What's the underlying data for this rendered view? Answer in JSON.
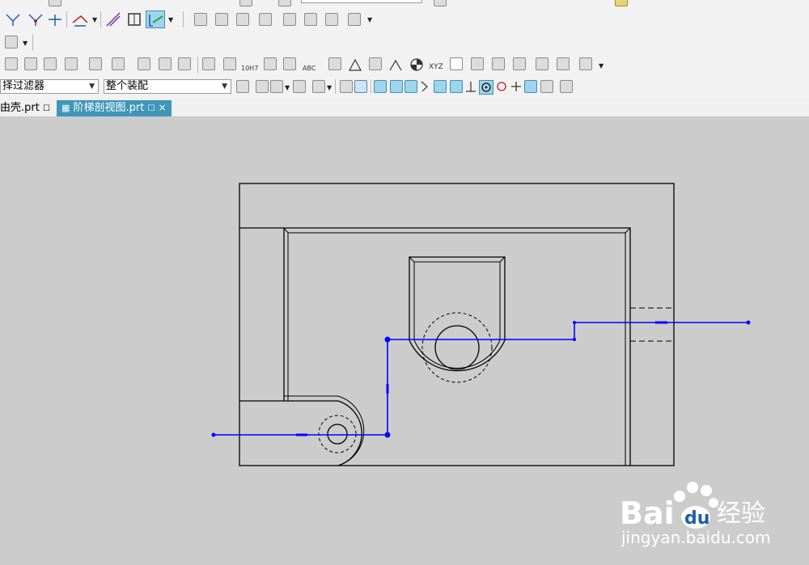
{
  "toolbar": {
    "selection_filter": {
      "value": "择过滤器"
    },
    "assembly_scope": {
      "value": "整个装配"
    },
    "icons": [
      "section-line-icon",
      "add-segment-icon",
      "delete-segment-icon",
      "move-segment-icon",
      "section-view-icon",
      "projected-view-icon",
      "step-section-active-icon",
      "base-view-icon",
      "view-style-icon",
      "update-view-icon",
      "view-boundary-icon",
      "break-view-icon",
      "detail-view-icon",
      "centerline-icon",
      "symmetric-centerline-icon",
      "bolt-circle-icon",
      "offset-centerpoint-icon",
      "dimension-icon",
      "tolerance-icon",
      "note-icon",
      "feature-control-frame-icon",
      "datum-icon",
      "surface-finish-icon",
      "weld-icon",
      "target-point-icon",
      "xyz-icon",
      "table-icon",
      "part-list-icon",
      "balloon-icon",
      "crosshatch-icon",
      "image-icon",
      "settings-icon",
      "pattern-icon",
      "show-hide-icon",
      "layer-icon",
      "snap-endpoint-icon",
      "snap-midpoint-icon",
      "snap-control-icon",
      "snap-tangent-icon",
      "snap-center-icon",
      "snap-quadrant-icon",
      "snap-intersection-icon",
      "snap-on-curve-icon",
      "snap-point-icon"
    ],
    "labels": {
      "dimension_fit": "10H7",
      "xyz": "XYZ",
      "abc": "ABC"
    }
  },
  "tabs": [
    {
      "label": "由壳.prt",
      "state": "inactive"
    },
    {
      "label": "阶梯剖视图.prt",
      "state": "active"
    }
  ],
  "drawing": {
    "line_color": "#000000",
    "section_line_color": "#0000ff",
    "background": "#cccccc"
  },
  "watermark": {
    "brand": "Bai",
    "brand_suffix": "du",
    "service": "经验",
    "url": "jingyan.baidu.com"
  }
}
